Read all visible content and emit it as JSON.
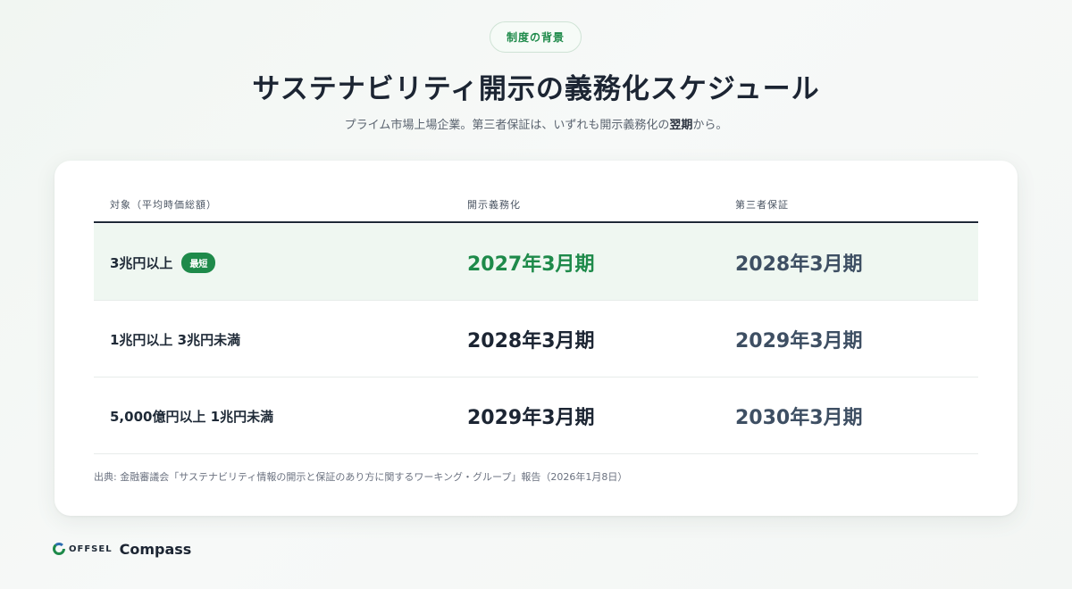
{
  "header": {
    "badge": "制度の背景",
    "title": "サステナビリティ開示の義務化スケジュール",
    "subtitle_pre": "プライム市場上場企業。第三者保証は、いずれも開示義務化の",
    "subtitle_bold": "翌期",
    "subtitle_post": "から。"
  },
  "table": {
    "headers": [
      "対象（平均時価総額）",
      "開示義務化",
      "第三者保証"
    ],
    "rows": [
      {
        "target": "3兆円以上",
        "tag": "最短",
        "disclosure": "2027年3月期",
        "assurance": "2028年3月期"
      },
      {
        "target": "1兆円以上 3兆円未満",
        "disclosure": "2028年3月期",
        "assurance": "2029年3月期"
      },
      {
        "target": "5,000億円以上 1兆円未満",
        "disclosure": "2029年3月期",
        "assurance": "2030年3月期"
      }
    ],
    "source": "出典: 金融審議会「サステナビリティ情報の開示と保証のあり方に関するワーキング・グループ」報告（2026年1月8日）"
  },
  "footer": {
    "brand": "OFFSEL",
    "product": "Compass"
  },
  "colors": {
    "accent": "#1e8a4a",
    "highlight_row": "#eff7f1"
  }
}
